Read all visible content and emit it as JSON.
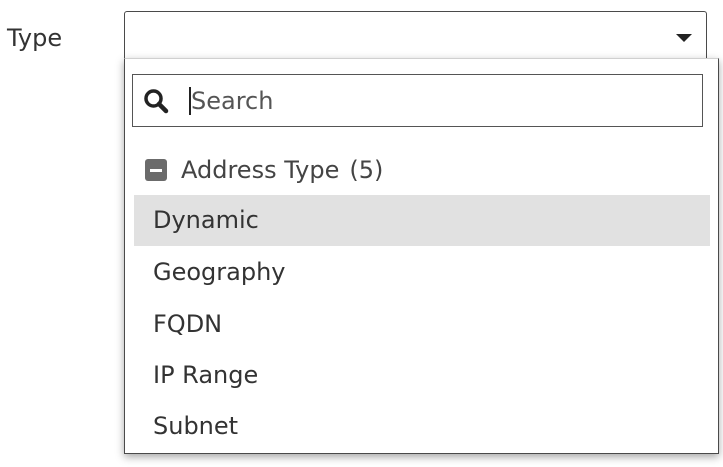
{
  "form": {
    "type_label": "Type",
    "selected_value": ""
  },
  "dropdown": {
    "search": {
      "placeholder": "Search",
      "value": ""
    },
    "group": {
      "label": "Address Type",
      "count": "(5)"
    },
    "options": [
      {
        "label": "Dynamic",
        "highlighted": true
      },
      {
        "label": "Geography",
        "highlighted": false
      },
      {
        "label": "FQDN",
        "highlighted": false
      },
      {
        "label": "IP Range",
        "highlighted": false
      },
      {
        "label": "Subnet",
        "highlighted": false
      }
    ]
  },
  "icons": {
    "caret": "chevron-down-icon",
    "search": "search-icon",
    "collapse": "collapse-minus-icon"
  },
  "colors": {
    "highlight": "#e1e1e1",
    "border": "#4a4a4a",
    "icon_gray": "#6b6b6b"
  }
}
